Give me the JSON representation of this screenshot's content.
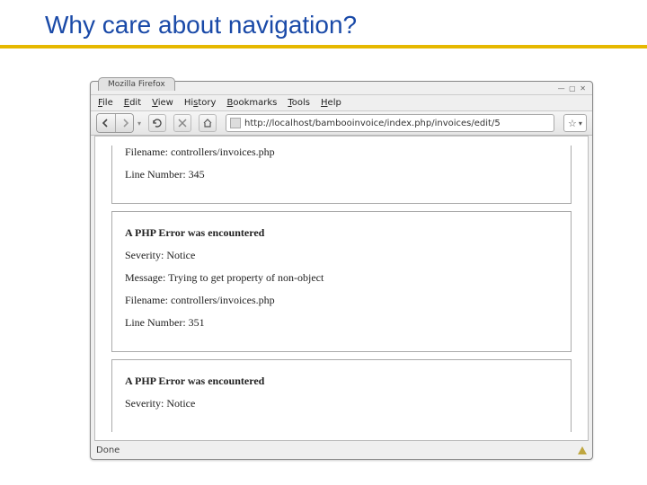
{
  "slide": {
    "title": "Why care about navigation?"
  },
  "window": {
    "tab_title": "Mozilla Firefox",
    "controls": "— ▢ ✕"
  },
  "menu": {
    "file": "File",
    "edit": "Edit",
    "view": "View",
    "history": "History",
    "bookmarks": "Bookmarks",
    "tools": "Tools",
    "help": "Help"
  },
  "toolbar": {
    "url": "http://localhost/bambooinvoice/index.php/invoices/edit/5",
    "star": "☆",
    "star_drop": "▾"
  },
  "errors": [
    {
      "filename": "Filename: controllers/invoices.php",
      "line": "Line Number: 345"
    },
    {
      "heading": "A PHP Error was encountered",
      "severity": "Severity: Notice",
      "message": "Message: Trying to get property of non-object",
      "filename": "Filename: controllers/invoices.php",
      "line": "Line Number: 351"
    },
    {
      "heading": "A PHP Error was encountered",
      "severity": "Severity: Notice"
    }
  ],
  "status": {
    "text": "Done"
  }
}
